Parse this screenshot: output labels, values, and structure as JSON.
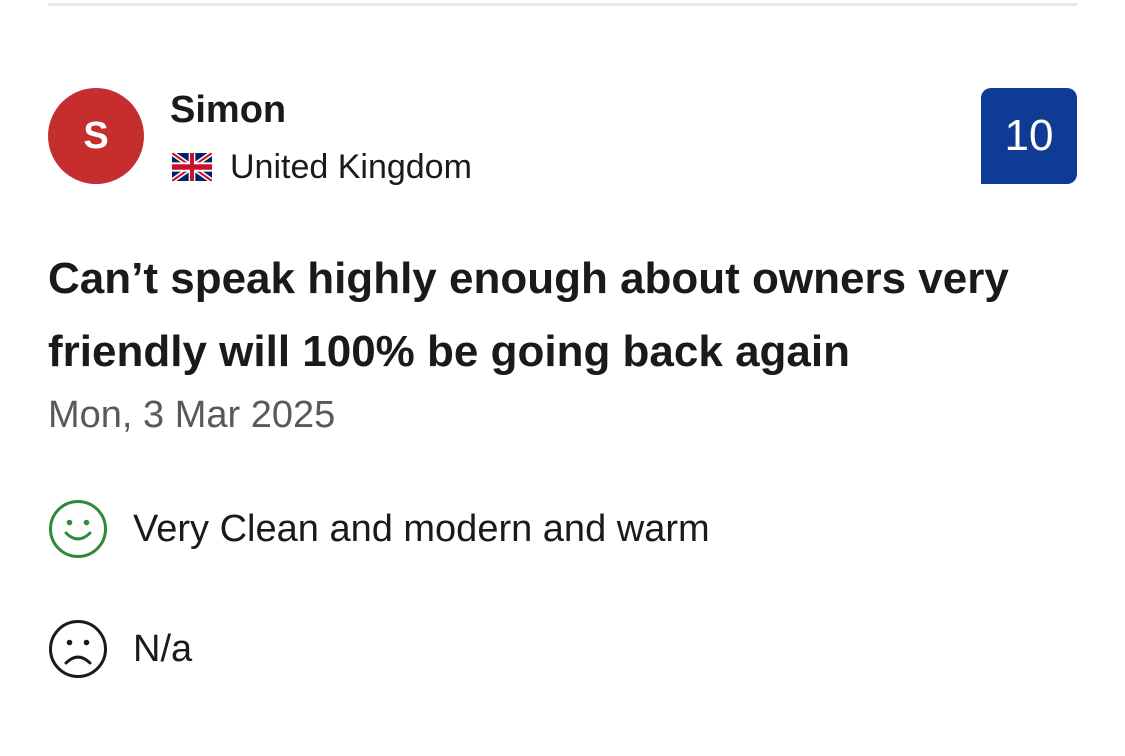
{
  "review": {
    "avatar_initial": "S",
    "reviewer_name": "Simon",
    "country": "United Kingdom",
    "score": "10",
    "title": "Can’t speak highly enough about owners very friendly will 100% be going back again",
    "date": "Mon, 3 Mar 2025",
    "positive": {
      "icon": "smile-icon",
      "text": "Very Clean and modern and warm"
    },
    "negative": {
      "icon": "frown-icon",
      "text": "N/a"
    }
  },
  "colors": {
    "avatar_bg": "#c62d2d",
    "score_bg": "#103b94",
    "positive_icon": "#2e8b3a",
    "negative_icon": "#1a1a1a",
    "date_text": "#595959"
  }
}
